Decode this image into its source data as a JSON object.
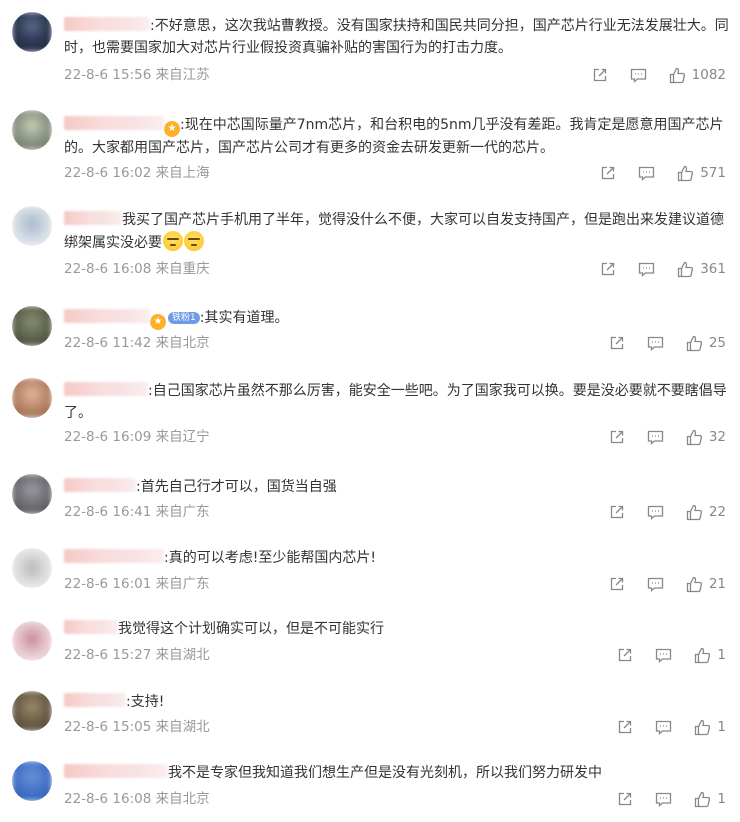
{
  "comments": [
    {
      "text": ":不好意思，这次我站曹教授。没有国家扶持和国民共同分担，国产芯片行业无法发展壮大。同时，也需要国家加大对芯片行业假投资真骗补贴的害国行为的打击力度。",
      "date": "22-8-6 15:56",
      "location": "来自江苏",
      "likes": "1082"
    },
    {
      "text": ":现在中芯国际量产7nm芯片，和台积电的5nm几乎没有差距。我肯定是愿意用国产芯片的。大家都用国产芯片，国产芯片公司才有更多的资金去研发更新一代的芯片。",
      "date": "22-8-6 16:02",
      "location": "来自上海",
      "likes": "571"
    },
    {
      "text": "我买了国产芯片手机用了半年，觉得没什么不便，大家可以自发支持国产，但是跑出来发建议道德绑架属实没必要",
      "date": "22-8-6 16:08",
      "location": "来自重庆",
      "likes": "361"
    },
    {
      "text": ":其实有道理。",
      "badge": "铁粉1",
      "date": "22-8-6 11:42",
      "location": "来自北京",
      "likes": "25"
    },
    {
      "text": ":自己国家芯片虽然不那么厉害，能安全一些吧。为了国家我可以换。要是没必要就不要瞎倡导了。",
      "date": "22-8-6 16:09",
      "location": "来自辽宁",
      "likes": "32"
    },
    {
      "text": ":首先自己行才可以，国货当自强",
      "date": "22-8-6 16:41",
      "location": "来自广东",
      "likes": "22"
    },
    {
      "text": ":真的可以考虑!至少能帮国内芯片!",
      "date": "22-8-6 16:01",
      "location": "来自广东",
      "likes": "21"
    },
    {
      "text": "我觉得这个计划确实可以，但是不可能实行",
      "date": "22-8-6 15:27",
      "location": "来自湖北",
      "likes": "1"
    },
    {
      "text": ":支持!",
      "date": "22-8-6 15:05",
      "location": "来自湖北",
      "likes": "1"
    },
    {
      "text": "我不是专家但我知道我们想生产但是没有光刻机，所以我们努力研发中",
      "date": "22-8-6 16:08",
      "location": "来自北京",
      "likes": "1"
    }
  ],
  "icons": {
    "share": "share-icon",
    "comment": "comment-icon",
    "like": "thumbs-up-icon"
  },
  "colors": {
    "text": "#333333",
    "meta": "#999999",
    "icon": "#888888",
    "badge": "#6f9be6"
  }
}
